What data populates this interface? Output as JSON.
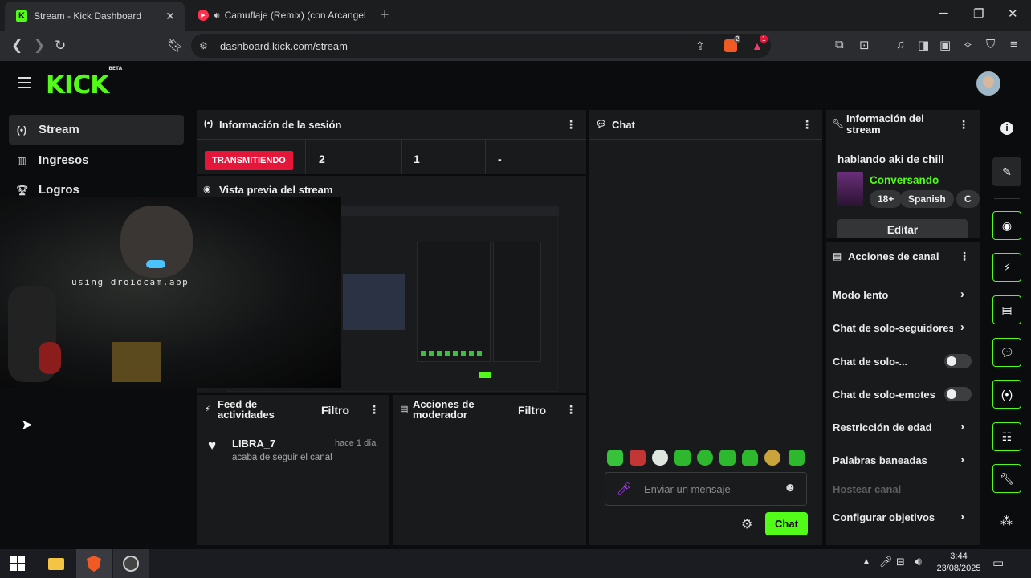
{
  "browser": {
    "tabs": [
      {
        "title": "Stream - Kick Dashboard",
        "active": true
      },
      {
        "title": "Camuflaje (Remix) (con Arcangel",
        "active": false
      }
    ],
    "url": "dashboard.kick.com/stream",
    "new_tab": "+",
    "window_controls": {
      "minimize": "─",
      "maximize": "❐",
      "close": "✕"
    },
    "ext_badges": {
      "brave": "2",
      "rewards": "1"
    }
  },
  "header": {
    "logo": "KICK",
    "logo_badge": "BETA"
  },
  "sidebar": {
    "items": [
      {
        "label": "Stream",
        "icon": "broadcast-icon",
        "active": true
      },
      {
        "label": "Ingresos",
        "icon": "chart-icon",
        "active": false
      },
      {
        "label": "Logros",
        "icon": "trophy-icon",
        "active": false
      }
    ]
  },
  "session": {
    "title": "Información de la sesión",
    "status": "TRANSMITIENDO",
    "stats": [
      "2",
      "1",
      "-"
    ]
  },
  "preview": {
    "title": "Vista previa del stream",
    "camera_overlay": "using droidcam.app"
  },
  "feed": {
    "title": "Feed de actividades",
    "filter": "Filtro",
    "events": [
      {
        "user": "LIBRA_7",
        "time": "hace 1 día",
        "text": "acaba de seguir el canal"
      }
    ]
  },
  "mod": {
    "title": "Acciones de moderador",
    "filter": "Filtro"
  },
  "chat": {
    "title": "Chat",
    "placeholder": "Enviar un mensaje",
    "send": "Chat"
  },
  "stream_info": {
    "title": "Información del stream",
    "stream_title": "hablando aki de chill",
    "category": "Conversando",
    "tags": [
      "18+",
      "Spanish",
      "C"
    ],
    "edit": "Editar"
  },
  "channel_actions": {
    "title": "Acciones de canal",
    "items": [
      {
        "label": "Modo lento",
        "control": "chevron"
      },
      {
        "label": "Chat de solo-seguidores",
        "control": "chevron"
      },
      {
        "label": "Chat de solo-...",
        "control": "toggle"
      },
      {
        "label": "Chat de solo-emotes",
        "control": "toggle"
      },
      {
        "label": "Restricción de edad",
        "control": "chevron"
      },
      {
        "label": "Palabras baneadas",
        "control": "chevron"
      },
      {
        "label": "Hostear canal",
        "control": "disabled"
      },
      {
        "label": "Configurar objetivos",
        "control": "chevron"
      }
    ]
  },
  "taskbar": {
    "time": "3:44",
    "date": "23/08/2025"
  },
  "colors": {
    "accent": "#53fc18",
    "live": "#e4173a",
    "panel": "#191a1b"
  }
}
